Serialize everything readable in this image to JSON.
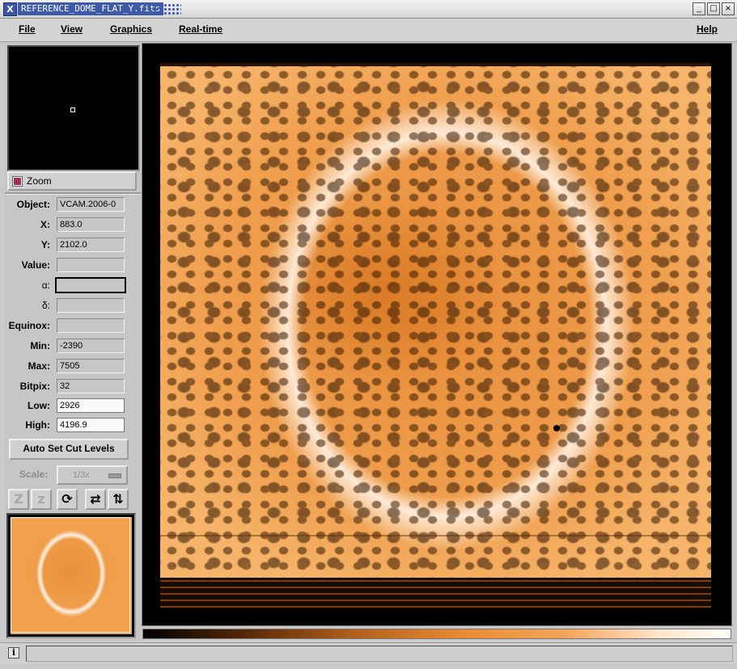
{
  "window": {
    "title": "REFERENCE_DOME_FLAT_Y.fits",
    "app_icon": "X",
    "controls": [
      "minimize",
      "maximize",
      "close"
    ]
  },
  "menubar": {
    "file": "File",
    "view": "View",
    "graphics": "Graphics",
    "realtime": "Real-time",
    "help": "Help"
  },
  "zoom": {
    "label": "Zoom",
    "checked": true
  },
  "info": {
    "object_label": "Object:",
    "object_value": "VCAM.2006-0",
    "x_label": "X:",
    "x_value": "883.0",
    "y_label": "Y:",
    "y_value": "2102.0",
    "value_label": "Value:",
    "value_value": "",
    "alpha_label": "α:",
    "alpha_value": "",
    "delta_label": "δ:",
    "delta_value": "",
    "equinox_label": "Equinox:",
    "equinox_value": "",
    "min_label": "Min:",
    "min_value": "-2390",
    "max_label": "Max:",
    "max_value": "7505",
    "bitpix_label": "Bitpix:",
    "bitpix_value": "32",
    "low_label": "Low:",
    "low_value": "2926",
    "high_label": "High:",
    "high_value": "4196.9"
  },
  "auto_cut_label": "Auto Set Cut Levels",
  "scale": {
    "label": "Scale:",
    "value": "1/3x"
  },
  "toolbar": {
    "zoom_in": "Z",
    "zoom_out": "z",
    "rotate": "⟳",
    "flip_x": "⇄",
    "flip_y": "⇅"
  },
  "colors": {
    "image_orange": "#ec8f39",
    "ring_white": "#fff2e6",
    "title_blue": "#3c5aa8"
  },
  "status": {
    "info_icon": "i",
    "message": ""
  }
}
